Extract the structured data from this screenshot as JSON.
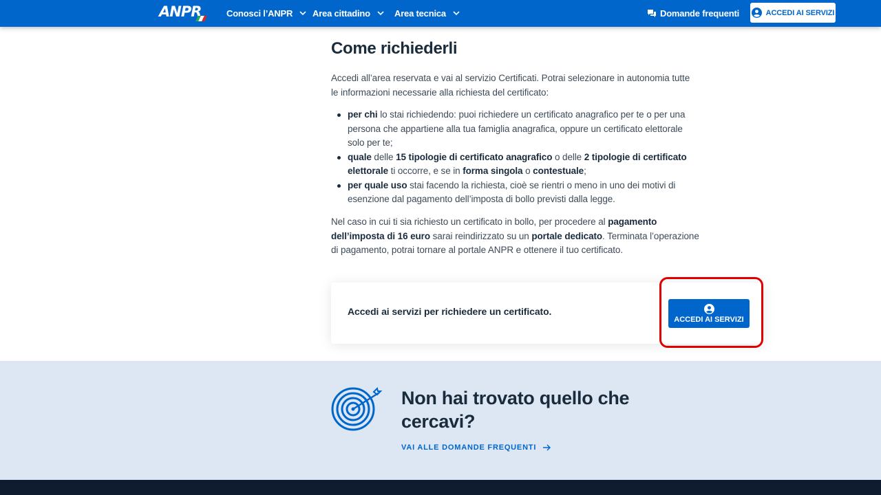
{
  "header": {
    "logo_text": "ANPR",
    "nav": [
      {
        "label": "Conosci l’ANPR"
      },
      {
        "label": "Area cittadino"
      },
      {
        "label": "Area tecnica"
      }
    ],
    "faq_label": "Domande frequenti",
    "access_button": "ACCEDI AI SERVIZI",
    "brand_color": "#0066cc"
  },
  "main": {
    "heading": "Come richiederli",
    "intro": "Accedi all’area reservata e vai al servizio Certificati. Potrai selezionare in autonomia tutte le informazioni necessarie alla richiesta del certificato:",
    "bullets": [
      {
        "b1": "per chi",
        "t1": " lo stai richiedendo: puoi richiedere un certificato anagrafico per te o per una persona che appartiene alla tua famiglia anagrafica, oppure un certificato elettorale solo per te;"
      },
      {
        "b1": "quale",
        "t1": " delle ",
        "b2": "15 tipologie di certificato anagrafico",
        "t2": " o delle ",
        "b3": "2 tipologie di certificato elettorale",
        "t3": " ti occorre, e se in ",
        "b4": "forma singola",
        "t4": " o ",
        "b5": "contestuale",
        "t5": ";"
      },
      {
        "b1": "per quale uso",
        "t1": " stai facendo la richiesta, cioè se rientri o meno in uno dei motivi di esenzione dal pagamento dell’imposta di bollo previsti dalla legge."
      }
    ],
    "payment": {
      "t1": "Nel caso in cui ti sia richiesto un certificato in bollo, per procedere al ",
      "b1": "pagamento dell’imposta di 16 euro",
      "t2": " sarai reindirizzato su un ",
      "b2": "portale dedicato",
      "t3": ". Terminata l’operazione di pagamento, potrai tornare al portale ANPR e ottenere il tuo certificato."
    }
  },
  "cta": {
    "text": "Accedi ai servizi per richiedere un certificato.",
    "button": "ACCEDI AI SERVIZI"
  },
  "faq_band": {
    "title": "Non hai trovato quello che cercavi?",
    "link": "VAI ALLE DOMANDE FREQUENTI"
  }
}
